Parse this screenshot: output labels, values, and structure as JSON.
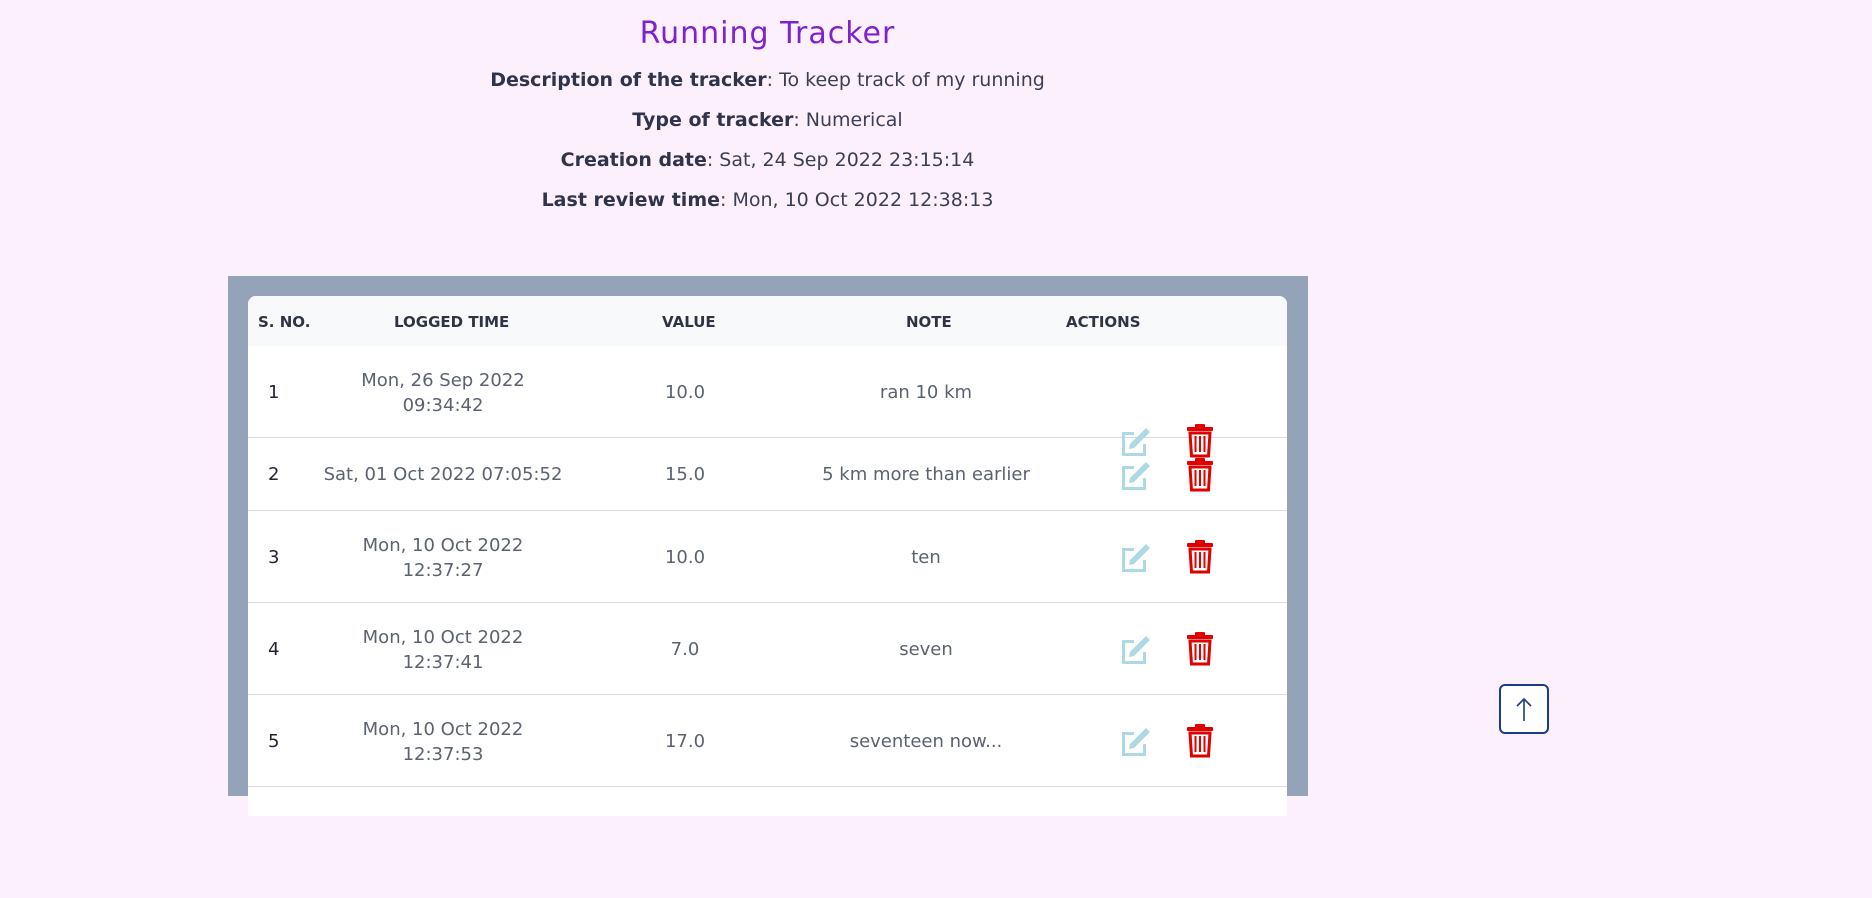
{
  "tracker": {
    "title": "Running Tracker",
    "description_label": "Description of the tracker",
    "description_value": ": To keep track of my running",
    "type_label": "Type of tracker",
    "type_value": ": Numerical",
    "creation_label": "Creation date",
    "creation_value": ": Sat, 24 Sep 2022 23:15:14",
    "review_label": "Last review time",
    "review_value": ": Mon, 10 Oct 2022 12:38:13"
  },
  "table": {
    "headers": [
      "S. NO.",
      "LOGGED TIME",
      "VALUE",
      "NOTE",
      "ACTIONS"
    ],
    "rows": [
      {
        "sno": "1",
        "time1": "Mon, 26 Sep 2022",
        "time2": "09:34:42",
        "value": "10.0",
        "note": "ran 10 km"
      },
      {
        "sno": "2",
        "time1": "Sat, 01 Oct 2022 07:05:52",
        "time2": "",
        "value": "15.0",
        "note": "5 km more than earlier"
      },
      {
        "sno": "3",
        "time1": "Mon, 10 Oct 2022",
        "time2": "12:37:27",
        "value": "10.0",
        "note": "ten"
      },
      {
        "sno": "4",
        "time1": "Mon, 10 Oct 2022",
        "time2": "12:37:41",
        "value": "7.0",
        "note": "seven"
      },
      {
        "sno": "5",
        "time1": "Mon, 10 Oct 2022",
        "time2": "12:37:53",
        "value": "17.0",
        "note": "seventeen now..."
      }
    ]
  },
  "icons": {
    "edit": "edit-icon",
    "delete": "trash-icon",
    "scroll_top": "arrow-up-icon"
  },
  "colors": {
    "title": "#7e22ce",
    "edit_icon": "#add8e6",
    "delete_icon": "#e00000",
    "table_frame": "#94a3b8"
  }
}
